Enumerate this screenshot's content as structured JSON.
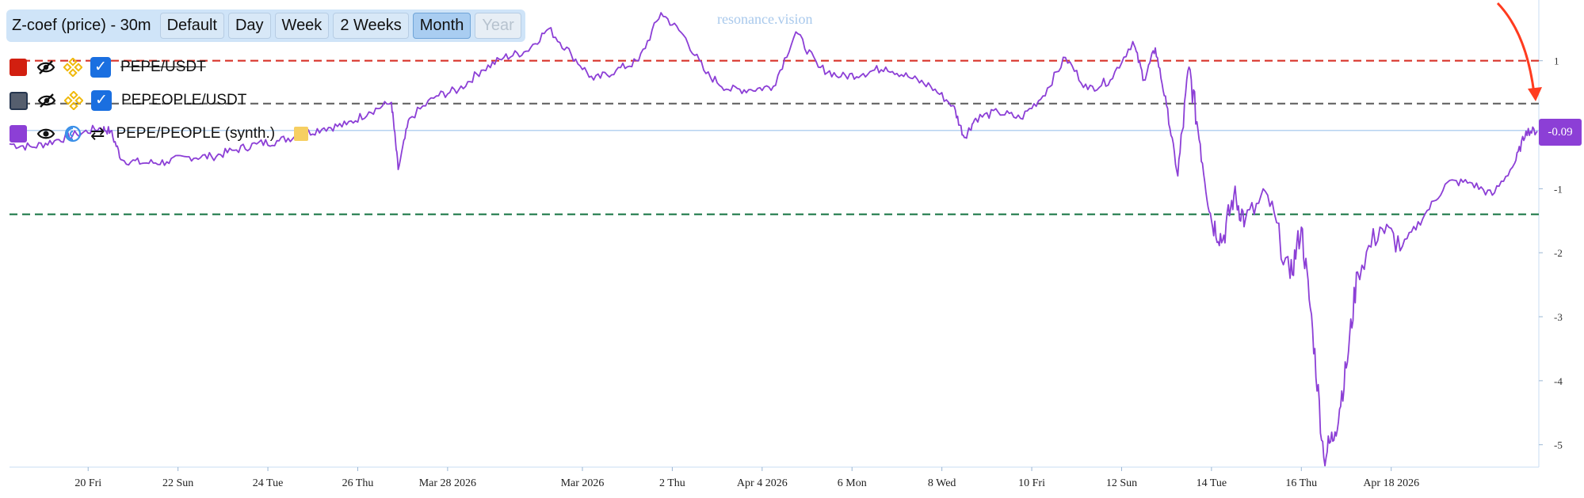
{
  "toolbar": {
    "title": "Z-coef (price) - 30m",
    "buttons": [
      {
        "label": "Default",
        "state": "normal"
      },
      {
        "label": "Day",
        "state": "normal"
      },
      {
        "label": "Week",
        "state": "normal"
      },
      {
        "label": "2 Weeks",
        "state": "normal"
      },
      {
        "label": "Month",
        "state": "active"
      },
      {
        "label": "Year",
        "state": "disabled"
      }
    ]
  },
  "legend": {
    "items": [
      {
        "name": "PEPE/USDT",
        "color": "#d21f10",
        "visible": false,
        "icon": "eye-off-icon",
        "checked": true,
        "source_icon": "binance-icon"
      },
      {
        "name": "PEPEOPLE/USDT",
        "color": "#555e6e",
        "visible": false,
        "icon": "eye-off-icon",
        "checked": true,
        "source_icon": "binance-icon"
      },
      {
        "name": "PEPE/PEOPLE (synth.)",
        "color": "#8c3fd6",
        "visible": true,
        "icon": "eye-icon",
        "source_icon": "synthetic-icon",
        "swap_icon": "swap-arrows-icon"
      }
    ]
  },
  "watermark": "resonance.vision",
  "price_tag": "-0.09",
  "chart_data": {
    "type": "line",
    "ylim": [
      -5.35,
      1.85
    ],
    "y_ticks": [
      {
        "value": 1,
        "label": "1"
      },
      {
        "value": -1,
        "label": "-1"
      },
      {
        "value": -2,
        "label": "-2"
      },
      {
        "value": -3,
        "label": "-3"
      },
      {
        "value": -4,
        "label": "-4"
      },
      {
        "value": -5,
        "label": "-5"
      }
    ],
    "x_ticks": [
      {
        "x": 3.5,
        "label": "20 Fri"
      },
      {
        "x": 7.5,
        "label": "22 Sun"
      },
      {
        "x": 11.5,
        "label": "24 Tue"
      },
      {
        "x": 15.5,
        "label": "26 Thu"
      },
      {
        "x": 19.5,
        "label": "Mar 28 2026"
      },
      {
        "x": 25.5,
        "label": "Mar 2026"
      },
      {
        "x": 29.5,
        "label": "2 Thu"
      },
      {
        "x": 33.5,
        "label": "Apr 4 2026"
      },
      {
        "x": 37.5,
        "label": "6 Mon"
      },
      {
        "x": 41.5,
        "label": "8 Wed"
      },
      {
        "x": 45.5,
        "label": "10 Fri"
      },
      {
        "x": 49.5,
        "label": "12 Sun"
      },
      {
        "x": 53.5,
        "label": "14 Tue"
      },
      {
        "x": 57.5,
        "label": "16 Thu"
      },
      {
        "x": 61.5,
        "label": "Apr 18 2026"
      }
    ],
    "xlim": [
      0,
      65
    ],
    "reference_lines": [
      {
        "value": 1.0,
        "color": "#d8342a",
        "style": "dashed"
      },
      {
        "value": 0.33,
        "color": "#6b6b6b",
        "style": "dashed"
      },
      {
        "value": -0.09,
        "color": "#9ec4ec",
        "style": "solid"
      },
      {
        "value": -1.4,
        "color": "#1f7a4a",
        "style": "dashed"
      }
    ],
    "series": [
      {
        "name": "PEPE/PEOPLE (synth.)",
        "color": "#8c3fd6",
        "points": [
          [
            0,
            -0.3
          ],
          [
            1,
            -0.35
          ],
          [
            2,
            -0.25
          ],
          [
            3,
            -0.15
          ],
          [
            4,
            -0.05
          ],
          [
            4.5,
            -0.1
          ],
          [
            5,
            -0.55
          ],
          [
            6,
            -0.6
          ],
          [
            7,
            -0.58
          ],
          [
            8,
            -0.5
          ],
          [
            9,
            -0.5
          ],
          [
            10,
            -0.4
          ],
          [
            11,
            -0.3
          ],
          [
            12,
            -0.25
          ],
          [
            13,
            -0.15
          ],
          [
            14,
            -0.05
          ],
          [
            15,
            0.0
          ],
          [
            16,
            0.2
          ],
          [
            17,
            0.35
          ],
          [
            17.3,
            -0.7
          ],
          [
            17.8,
            0.1
          ],
          [
            19,
            0.45
          ],
          [
            20,
            0.55
          ],
          [
            21,
            0.85
          ],
          [
            22,
            1.05
          ],
          [
            23,
            1.15
          ],
          [
            24,
            1.5
          ],
          [
            25,
            1.1
          ],
          [
            26,
            0.7
          ],
          [
            27,
            0.85
          ],
          [
            28,
            1.0
          ],
          [
            29,
            1.75
          ],
          [
            30,
            1.4
          ],
          [
            31,
            0.8
          ],
          [
            32,
            0.55
          ],
          [
            33,
            0.55
          ],
          [
            34,
            0.6
          ],
          [
            35,
            1.45
          ],
          [
            36,
            0.9
          ],
          [
            37,
            0.75
          ],
          [
            38,
            0.8
          ],
          [
            39,
            0.9
          ],
          [
            40,
            0.75
          ],
          [
            41,
            0.6
          ],
          [
            42,
            0.3
          ],
          [
            42.5,
            -0.2
          ],
          [
            43,
            0.1
          ],
          [
            44,
            0.2
          ],
          [
            45,
            0.1
          ],
          [
            46,
            0.45
          ],
          [
            47,
            1.05
          ],
          [
            48,
            0.55
          ],
          [
            49,
            0.7
          ],
          [
            50,
            1.3
          ],
          [
            50.5,
            0.7
          ],
          [
            51,
            1.2
          ],
          [
            51.5,
            0.3
          ],
          [
            52,
            -0.8
          ],
          [
            52.5,
            0.9
          ],
          [
            53,
            -0.3
          ],
          [
            53.5,
            -1.5
          ],
          [
            54,
            -1.8
          ],
          [
            54.5,
            -1.1
          ],
          [
            55,
            -1.5
          ],
          [
            56,
            -1.1
          ],
          [
            57,
            -2.4
          ],
          [
            57.5,
            -1.6
          ],
          [
            58,
            -3.2
          ],
          [
            58.5,
            -5.2
          ],
          [
            59,
            -4.8
          ],
          [
            59.5,
            -3.8
          ],
          [
            60,
            -2.3
          ],
          [
            61,
            -1.6
          ],
          [
            62,
            -1.9
          ],
          [
            63,
            -1.4
          ],
          [
            64,
            -0.9
          ],
          [
            65,
            -0.9
          ],
          [
            66,
            -1.1
          ],
          [
            67,
            -0.6
          ],
          [
            67.5,
            -0.1
          ],
          [
            68,
            -0.1
          ]
        ]
      }
    ]
  }
}
